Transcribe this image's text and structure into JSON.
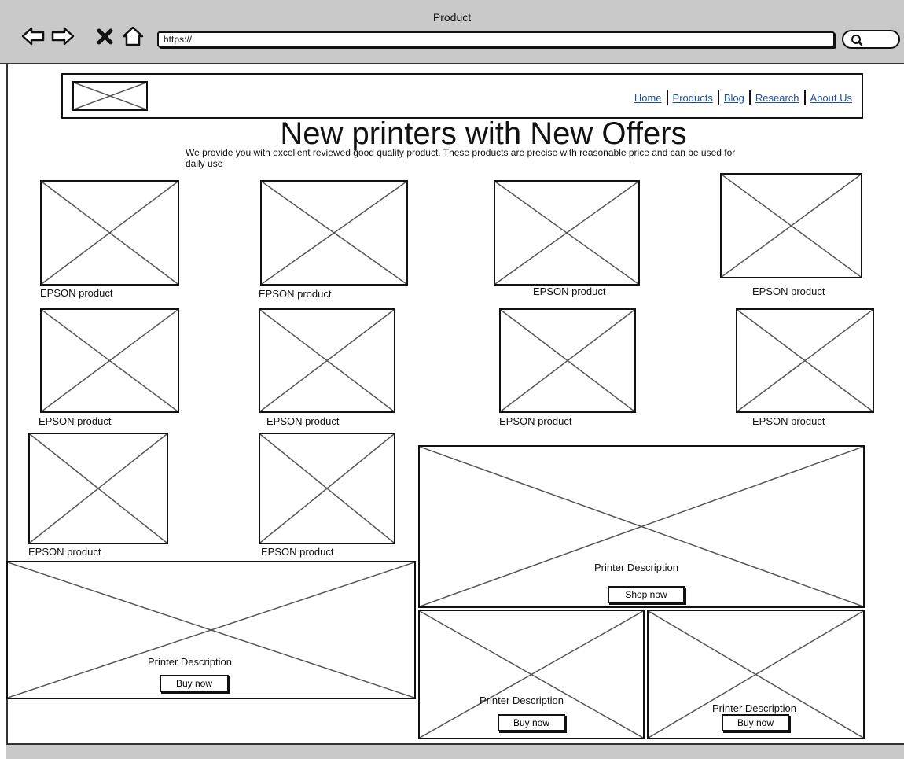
{
  "browser": {
    "window_title": "Product",
    "url": "https://"
  },
  "header": {
    "logo_icon": "image-placeholder-icon",
    "nav": [
      {
        "label": "Home"
      },
      {
        "label": "Products"
      },
      {
        "label": "Blog"
      },
      {
        "label": "Research"
      },
      {
        "label": "About Us"
      }
    ]
  },
  "hero": {
    "title": "New printers with New Offers",
    "description": "We provide you with excellent reviewed good quality product. These products are precise with reasonable price and can be used for daily use"
  },
  "products": [
    {
      "label": "EPSON  product"
    },
    {
      "label": "EPSON product"
    },
    {
      "label": "EPSON product"
    },
    {
      "label": "EPSON product"
    },
    {
      "label": "EPSON product"
    },
    {
      "label": "EPSON product"
    },
    {
      "label": "EPSON product"
    },
    {
      "label": "EPSON product"
    },
    {
      "label": "EPSON product"
    },
    {
      "label": "EPSON product"
    }
  ],
  "promos": [
    {
      "description": "Printer Description",
      "button": "Shop now"
    },
    {
      "description": "Printer Description",
      "button": "Buy now"
    },
    {
      "description": "Printer Description",
      "button": "Buy now"
    },
    {
      "description": "Printer Description",
      "button": "Buy now"
    }
  ]
}
